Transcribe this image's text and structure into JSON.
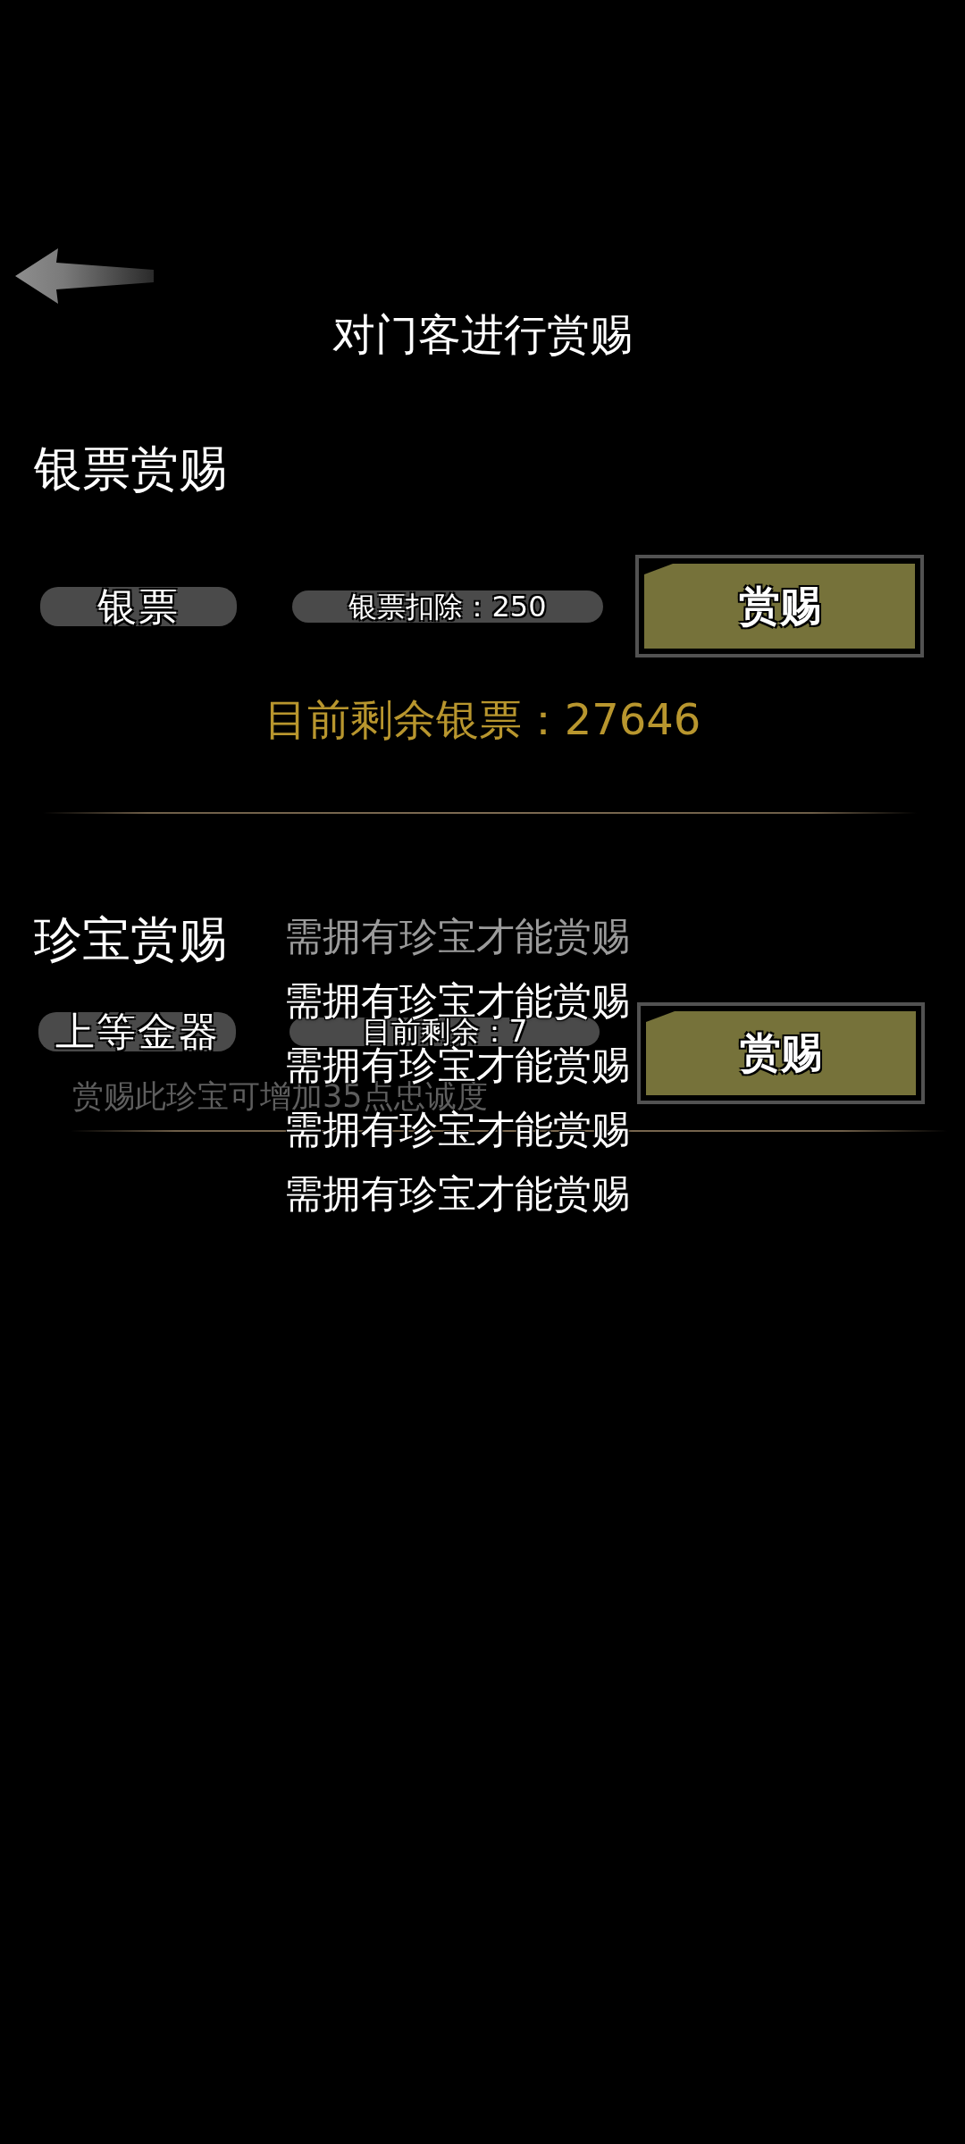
{
  "header": {
    "title": "对门客进行赏赐"
  },
  "silver_reward": {
    "heading": "银票赏赐",
    "item": "银票",
    "cost": "银票扣除：250",
    "button": "赏赐",
    "remaining": "目前剩余银票：27646"
  },
  "treasure_reward": {
    "heading": "珍宝赏赐",
    "item": "上等金器",
    "remaining": "目前剩余：7",
    "button": "赏赐",
    "description": "赏赐此珍宝可增加35点忠诚度"
  },
  "toasts": [
    {
      "text": "需拥有珍宝才能赏赐",
      "dimmed": true
    },
    {
      "text": "需拥有珍宝才能赏赐",
      "dimmed": false
    },
    {
      "text": "需拥有珍宝才能赏赐",
      "dimmed": false
    },
    {
      "text": "需拥有珍宝才能赏赐",
      "dimmed": false
    },
    {
      "text": "需拥有珍宝才能赏赐",
      "dimmed": false
    }
  ]
}
